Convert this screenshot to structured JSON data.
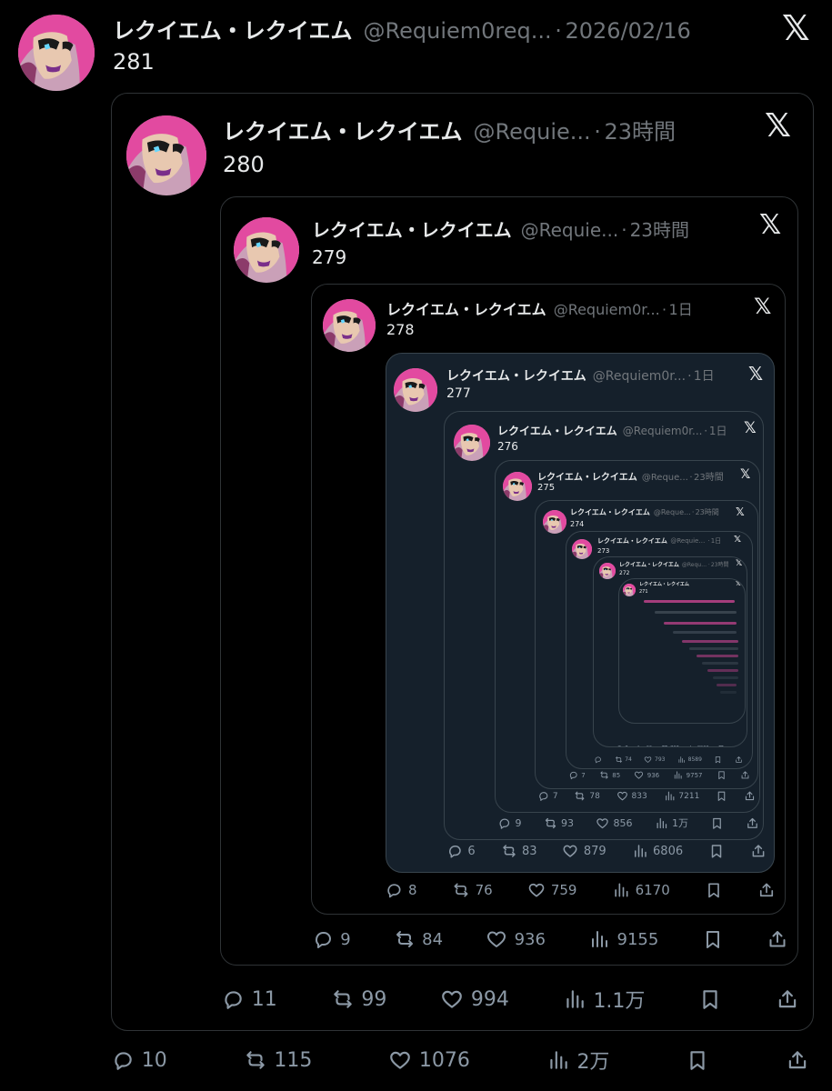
{
  "account": {
    "display_name": "レクイエム・レクイエム",
    "handles": {
      "long": "@Requiem0req...",
      "mid": "@Requiem0r...",
      "short": "@Requie...",
      "tiny": "@Reque..."
    },
    "icons": {
      "avatar": "character-portrait-avatar",
      "platform": "x-logo",
      "reply": "reply-icon",
      "repost": "repost-icon",
      "like": "heart-icon",
      "views": "views-icon",
      "bookmark": "bookmark-icon",
      "share": "share-icon"
    }
  },
  "posts": [
    {
      "number": "281",
      "handle": "@Requiem0req...",
      "time": "2026/02/16",
      "stats": {
        "reply": "10",
        "repost": "115",
        "like": "1076",
        "views": "2万"
      }
    },
    {
      "number": "280",
      "handle": "@Requie...",
      "time": "23時間",
      "stats": {
        "reply": "11",
        "repost": "99",
        "like": "994",
        "views": "1.1万"
      }
    },
    {
      "number": "279",
      "handle": "@Requie...",
      "time": "23時間",
      "stats": {
        "reply": "9",
        "repost": "84",
        "like": "936",
        "views": "9155"
      }
    },
    {
      "number": "278",
      "handle": "@Requiem0r...",
      "time": "1日",
      "stats": {
        "reply": "8",
        "repost": "76",
        "like": "759",
        "views": "6170"
      }
    },
    {
      "number": "277",
      "handle": "@Requiem0r...",
      "time": "1日",
      "stats": {
        "reply": "6",
        "repost": "83",
        "like": "879",
        "views": "6806"
      }
    },
    {
      "number": "276",
      "handle": "@Requiem0r...",
      "time": "1日",
      "stats": {
        "reply": "9",
        "repost": "93",
        "like": "856",
        "views": "1万"
      }
    },
    {
      "number": "275",
      "handle": "@Reque...",
      "time": "23時間",
      "stats": {
        "reply": "7",
        "repost": "78",
        "like": "833",
        "views": "7211"
      }
    },
    {
      "number": "274",
      "handle": "@Reque...",
      "time": "23時間",
      "stats": {
        "reply": "7",
        "repost": "85",
        "like": "936",
        "views": "9757"
      }
    },
    {
      "number": "273",
      "handle": "@Requiem0r...",
      "time": "1日",
      "stats": {
        "reply": "",
        "repost": "74",
        "like": "793",
        "views": "8589"
      }
    },
    {
      "number": "272",
      "handle": "@Reque...",
      "time": "23時間",
      "stats": {
        "reply": "7",
        "repost": "66",
        "like": "787",
        "views": "8908"
      }
    },
    {
      "number": "271",
      "handle": "",
      "time": "",
      "stats": {
        "reply": "",
        "repost": "",
        "like": "",
        "views": ""
      }
    }
  ],
  "colors": {
    "background": "#000000",
    "dim_background": "#15202b",
    "border": "#2f3336",
    "text": "#e7e9ea",
    "muted": "#71767b",
    "avatar_pink": "#e24aa0"
  }
}
